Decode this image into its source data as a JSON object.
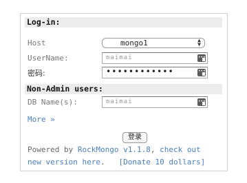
{
  "login": {
    "section_title": "Log-in:",
    "host_label": "Host",
    "host_value": "mongo1",
    "username_label": "UserName:",
    "username_value": "maimai",
    "password_label": "密码:",
    "password_value": "••••••••••••"
  },
  "nonadmin": {
    "section_title": "Non-Admin users:",
    "dbname_label": "DB Name(s):",
    "dbname_value": "maimai"
  },
  "more_link": "More »",
  "submit_label": "登录",
  "footer": {
    "prefix": "Powered by ",
    "product": "RockMongo v1.1.8",
    "comma": ",",
    "check_out": "check out",
    "new_version": "new version here",
    "period": ".",
    "donate": "[Donate 10 dollars]"
  }
}
